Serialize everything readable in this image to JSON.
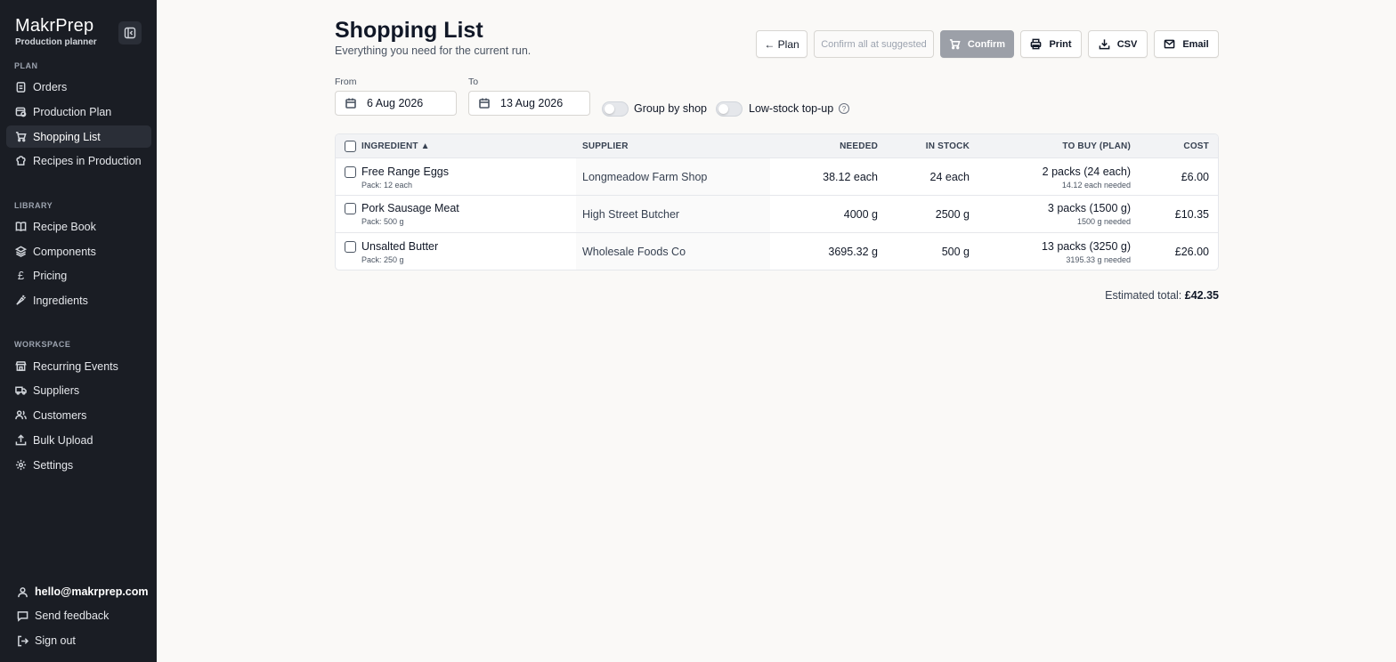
{
  "brand": {
    "name": "MakrPrep",
    "subtitle": "Production planner"
  },
  "sidebar": {
    "sections": [
      {
        "label": "PLAN",
        "items": [
          {
            "label": "Orders",
            "icon": "clipboard-icon"
          },
          {
            "label": "Production Plan",
            "icon": "calendar-clock-icon"
          },
          {
            "label": "Shopping List",
            "icon": "cart-icon",
            "active": true
          },
          {
            "label": "Recipes in Production",
            "icon": "chef-hat-icon"
          }
        ]
      },
      {
        "label": "LIBRARY",
        "items": [
          {
            "label": "Recipe Book",
            "icon": "book-icon"
          },
          {
            "label": "Components",
            "icon": "layers-icon"
          },
          {
            "label": "Pricing",
            "icon": "pound-icon"
          },
          {
            "label": "Ingredients",
            "icon": "carrot-icon"
          }
        ]
      },
      {
        "label": "WORKSPACE",
        "items": [
          {
            "label": "Recurring Events",
            "icon": "store-icon"
          },
          {
            "label": "Suppliers",
            "icon": "truck-icon"
          },
          {
            "label": "Customers",
            "icon": "users-icon"
          },
          {
            "label": "Bulk Upload",
            "icon": "upload-icon"
          },
          {
            "label": "Settings",
            "icon": "gear-icon"
          }
        ]
      }
    ],
    "footer": {
      "user_email": "hello@makrprep.com",
      "feedback": "Send feedback",
      "sign_out": "Sign out"
    }
  },
  "header": {
    "title": "Shopping List",
    "subtitle": "Everything you need for the current run."
  },
  "toolbar": {
    "plan": "← Plan",
    "confirm_all": "Confirm all at suggested",
    "confirm": "Confirm",
    "print": "Print",
    "csv": "CSV",
    "email": "Email"
  },
  "filters": {
    "from_label": "From",
    "from_value": "6 Aug 2026",
    "to_label": "To",
    "to_value": "13 Aug 2026",
    "group_by_shop": "Group by shop",
    "low_stock": "Low-stock top-up",
    "group_by_shop_on": false,
    "low_stock_on": false
  },
  "table": {
    "headers": {
      "ingredient": "INGREDIENT ▲",
      "supplier": "SUPPLIER",
      "needed": "NEEDED",
      "in_stock": "IN STOCK",
      "to_buy": "TO BUY (PLAN)",
      "cost": "COST"
    },
    "rows": [
      {
        "ingredient": "Free Range Eggs",
        "pack": "Pack: 12 each",
        "supplier": "Longmeadow Farm Shop",
        "needed": "38.12 each",
        "in_stock": "24 each",
        "to_buy": "2 packs (24 each)",
        "to_buy_note": "14.12 each needed",
        "cost": "£6.00"
      },
      {
        "ingredient": "Pork Sausage Meat",
        "pack": "Pack: 500 g",
        "supplier": "High Street Butcher",
        "needed": "4000 g",
        "in_stock": "2500 g",
        "to_buy": "3 packs (1500 g)",
        "to_buy_note": "1500 g needed",
        "cost": "£10.35"
      },
      {
        "ingredient": "Unsalted Butter",
        "pack": "Pack: 250 g",
        "supplier": "Wholesale Foods Co",
        "needed": "3695.32 g",
        "in_stock": "500 g",
        "to_buy": "13 packs (3250 g)",
        "to_buy_note": "3195.33 g needed",
        "cost": "£26.00"
      }
    ]
  },
  "total": {
    "label": "Estimated total:",
    "value": "£42.35"
  },
  "colors": {
    "sidebar_bg": "#1a1d24",
    "page_bg": "#faf9f7",
    "primary_disabled": "#9ca0a8"
  }
}
